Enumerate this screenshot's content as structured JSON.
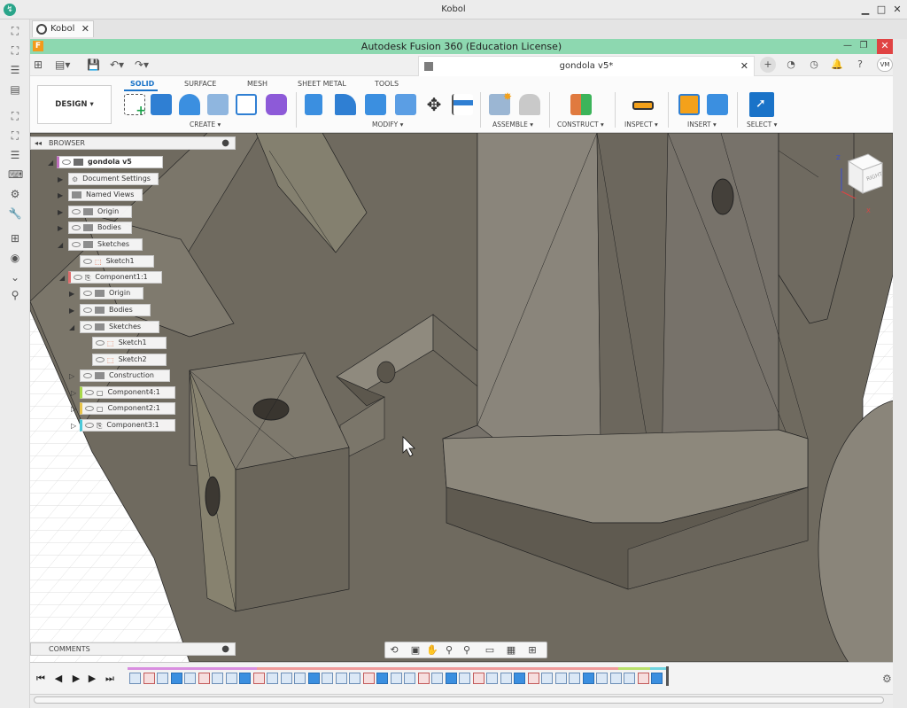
{
  "window": {
    "title": "Kobol",
    "minimize": "▁",
    "maximize": "□",
    "close": "✕"
  },
  "browser_tab": {
    "label": "Kobol",
    "close": "✕"
  },
  "fusion": {
    "title": "Autodesk Fusion 360 (Education License)",
    "logo": "F"
  },
  "document": {
    "name": "gondola v5*",
    "close": "✕",
    "user_initials": "VM"
  },
  "ribbon": {
    "workspace_label": "DESIGN ▾",
    "tabs": [
      "SOLID",
      "SURFACE",
      "MESH",
      "SHEET METAL",
      "TOOLS"
    ],
    "groups": [
      "CREATE ▾",
      "MODIFY ▾",
      "ASSEMBLE ▾",
      "CONSTRUCT ▾",
      "INSPECT ▾",
      "INSERT ▾",
      "SELECT ▾"
    ]
  },
  "browser": {
    "header": "BROWSER",
    "nodes": [
      {
        "label": "gondola v5"
      },
      {
        "label": "Document Settings"
      },
      {
        "label": "Named Views"
      },
      {
        "label": "Origin"
      },
      {
        "label": "Bodies"
      },
      {
        "label": "Sketches"
      },
      {
        "label": "Sketch1"
      },
      {
        "label": "Component1:1"
      },
      {
        "label": "Origin"
      },
      {
        "label": "Bodies"
      },
      {
        "label": "Sketches"
      },
      {
        "label": "Sketch1"
      },
      {
        "label": "Sketch2"
      },
      {
        "label": "Construction"
      },
      {
        "label": "Component4:1"
      },
      {
        "label": "Component2:1"
      },
      {
        "label": "Component3:1"
      }
    ]
  },
  "comments": {
    "label": "COMMENTS"
  },
  "viewcube": {
    "face_label": "RIGHT",
    "axis_x": "X",
    "axis_z": "Z"
  },
  "colors": {
    "title_bar": "#8dd8b0",
    "accent": "#1a73c8",
    "close": "#e04343",
    "model": "#8a8478"
  }
}
